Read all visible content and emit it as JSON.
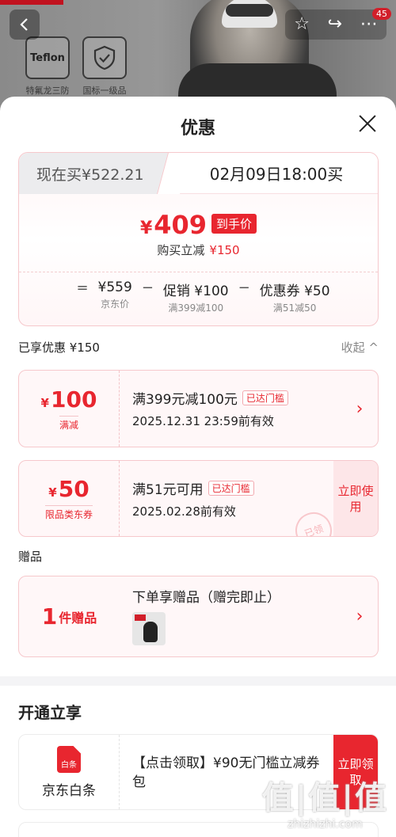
{
  "nav": {
    "badge": "45"
  },
  "features": [
    {
      "icon_text": "Teflon",
      "label": "特氟龙三防"
    },
    {
      "label": "国标一级品"
    }
  ],
  "sheet": {
    "title": "优惠"
  },
  "price_card": {
    "buy_now": "现在买¥522.21",
    "buy_later": "02月09日18:00买",
    "final_yen": "¥",
    "final_price": "409",
    "final_tag": "到手价",
    "direct_cut_label": "购买立减",
    "direct_cut_amount": "¥150",
    "calc": {
      "eq": "=",
      "minus": "−",
      "base_value": "¥559",
      "base_label": "京东价",
      "promo_value": "促销 ¥100",
      "promo_label": "满399减100",
      "coupon_value": "优惠券 ¥50",
      "coupon_label": "满51减50"
    }
  },
  "enjoyed": {
    "label": "已享优惠 ¥150",
    "collapse": "收起 ^"
  },
  "coupons": [
    {
      "yen": "¥",
      "amount": "100",
      "tag": "满减",
      "title": "满399元减100元",
      "status": "已达门槛",
      "expiry": "2025.12.31 23:59前有效",
      "arrow": "›"
    },
    {
      "yen": "¥",
      "amount": "50",
      "tag": "限品类东券",
      "title": "满51元可用",
      "status": "已达门槛",
      "expiry": "2025.02.28前有效",
      "action": "立即使用",
      "stamp": "已领"
    }
  ],
  "gift": {
    "section_title": "赠品",
    "count": "1",
    "unit": "件赠品",
    "title": "下单享赠品（赠完即止）",
    "arrow": "›"
  },
  "open": {
    "title": "开通立享",
    "logo_text": "白条",
    "name": "京东白条",
    "desc": "【点击领取】¥90无门槛立减券包",
    "button": "立即领取"
  },
  "watermark": {
    "big": "值|值|值",
    "small": "zhizhizhi.com"
  }
}
